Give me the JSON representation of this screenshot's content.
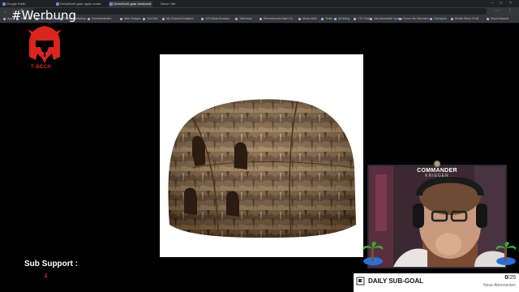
{
  "browser": {
    "tabs": [
      {
        "label": "Google Earth"
      },
      {
        "label": "Schnellzelt gaar apple smart"
      },
      {
        "label": "Schnellzelt gaar Ansitzzelt",
        "active": true
      },
      {
        "label": "Neuer Tab"
      }
    ],
    "bookmarks": [
      "Apps",
      "YouTube",
      "Twitch Chat",
      "Steam Workshop",
      "Firemeltmenttro",
      "Web Designs",
      "YouTube",
      "My Channel Analytics",
      "GTA Mods Browser",
      "Twitchnax",
      "Remmensche Alarm Tu",
      "Music table",
      "Tenks",
      "ItsTiming",
      "TTV Chat",
      "Das Amtshafte System",
      "Forum der Sternabre",
      "Gamepick",
      "Reddit Mirror Profil",
      "Sound Boards"
    ]
  },
  "overlay": {
    "ad_label": "#Werbung",
    "logo_text": "T-BECH",
    "sub_support_label": "Sub Support :",
    "sub_support_count": "4"
  },
  "webcam": {
    "name_line1": "COMMANDER",
    "name_line2": "KRIEGER"
  },
  "goal": {
    "title": "DAILY SUB-GOAL",
    "current": "0",
    "target": "/25",
    "subtitle": "Neue Abonnenten"
  },
  "colors": {
    "accent_red": "#d8261f",
    "sub_count_red": "#e53030"
  }
}
